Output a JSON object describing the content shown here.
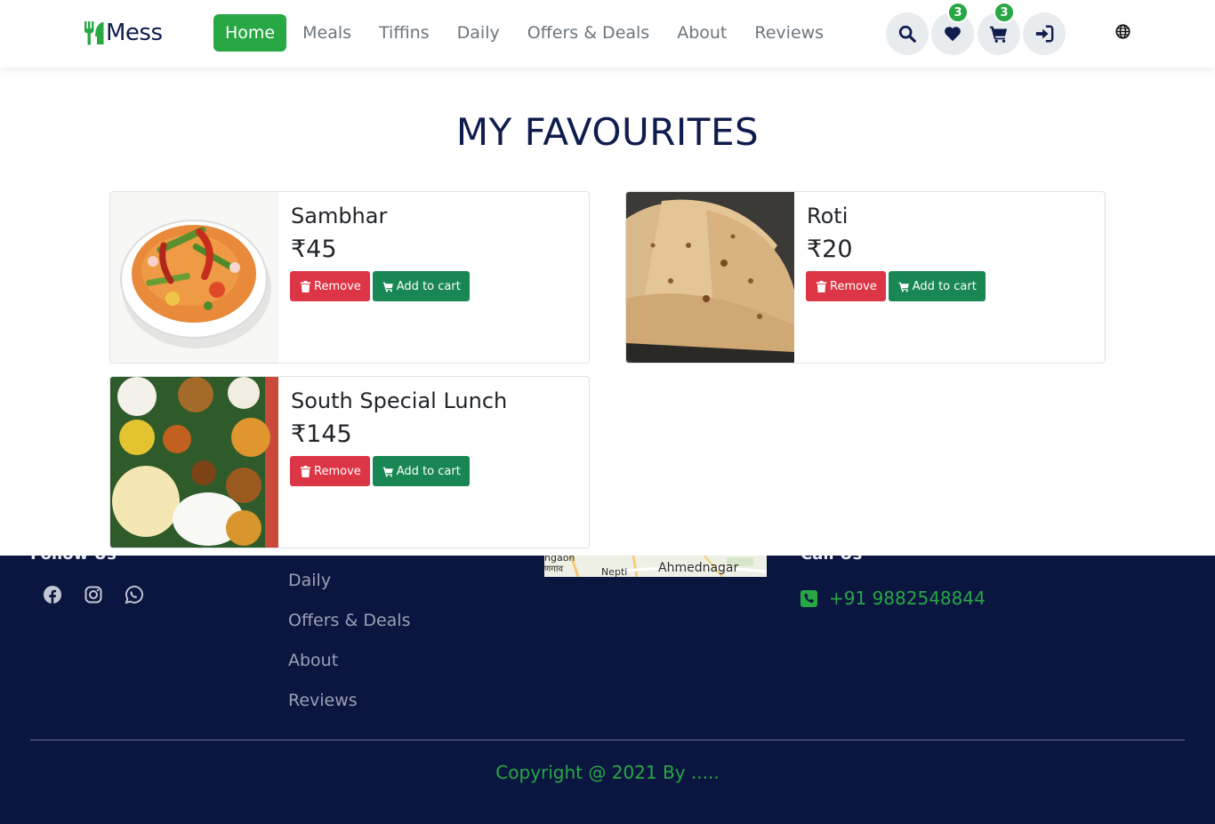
{
  "nav": {
    "brand": "Mess",
    "links": [
      {
        "label": "Home",
        "active": true
      },
      {
        "label": "Meals",
        "active": false
      },
      {
        "label": "Tiffins",
        "active": false
      },
      {
        "label": "Daily",
        "active": false
      },
      {
        "label": "Offers & Deals",
        "active": false
      },
      {
        "label": "About",
        "active": false
      },
      {
        "label": "Reviews",
        "active": false
      }
    ],
    "icons": [
      "search-icon",
      "heart-icon",
      "cart-icon",
      "sign-in-icon",
      "globe-icon"
    ],
    "favourites_count": "3",
    "cart_count": "3"
  },
  "main": {
    "title": "MY FAVOURITES",
    "items": [
      {
        "name": "Sambhar",
        "price": "₹45",
        "remove_label": "Remove",
        "add_label": "Add to cart"
      },
      {
        "name": "Roti",
        "price": "₹20",
        "remove_label": "Remove",
        "add_label": "Add to cart"
      },
      {
        "name": "South Special Lunch",
        "price": "₹145",
        "remove_label": "Remove",
        "add_label": "Add to cart"
      }
    ]
  },
  "footer": {
    "follow_heading": "Follow Us",
    "social_icons": [
      "facebook-icon",
      "instagram-icon",
      "whatsapp-icon"
    ],
    "links": [
      "Daily",
      "Offers & Deals",
      "About",
      "Reviews"
    ],
    "map_labels": [
      "ngaon",
      "णगाव",
      "Nepti",
      "Ahmednagar"
    ],
    "call_heading": "Call Us",
    "phone": "+91 9882548844",
    "copyright": "Copyright @ 2021 By ....."
  },
  "colors": {
    "brand_green": "#28a745",
    "add_button": "#198754",
    "remove_button": "#dc3545",
    "navy": "#0f1c4d",
    "footer_bg": "#0b1640"
  }
}
